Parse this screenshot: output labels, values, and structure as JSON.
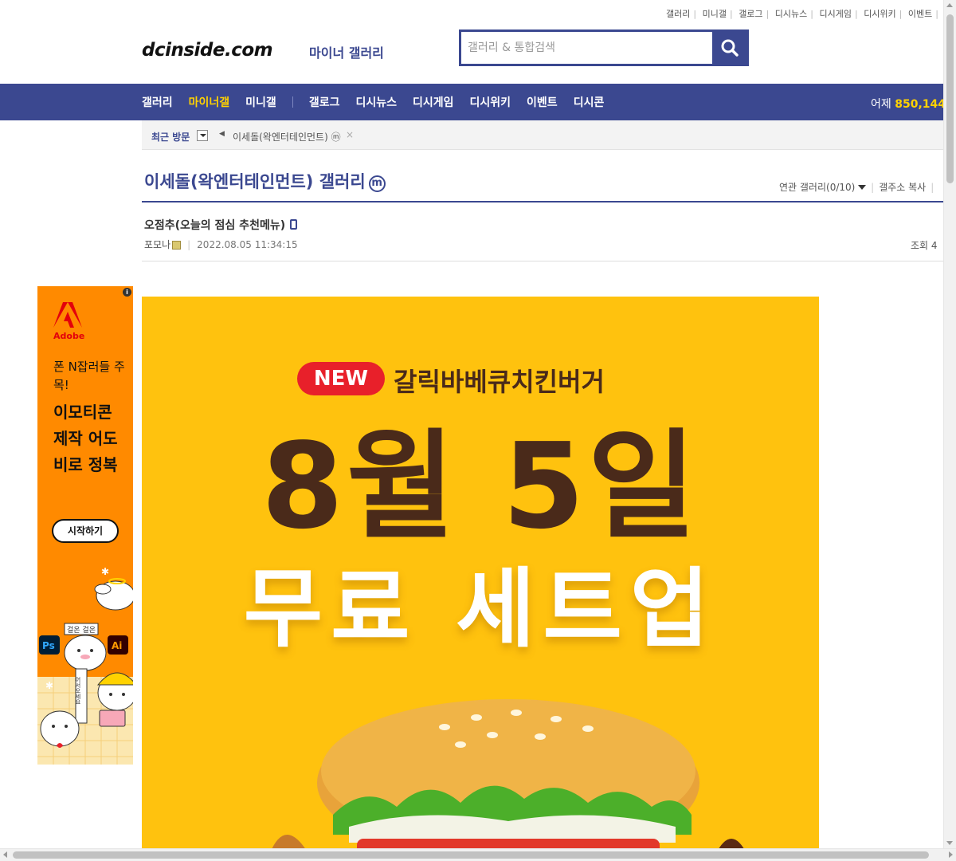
{
  "util_links": [
    "갤러리",
    "미니갤",
    "갤로그",
    "디시뉴스",
    "디시게임",
    "디시위키",
    "이벤트"
  ],
  "header": {
    "logo": "dcinside.com",
    "logo_sub": "마이너 갤러리",
    "search_placeholder": "갤러리 & 통합검색"
  },
  "nav": {
    "items": [
      "갤러리",
      "마이너갤",
      "미니갤",
      "갤로그",
      "디시뉴스",
      "디시게임",
      "디시위키",
      "이벤트",
      "디시콘"
    ],
    "active": "마이너갤",
    "visitors_label": "어제",
    "visitors_value": "850,144"
  },
  "recent": {
    "label": "최근 방문",
    "item": "이세돌(왁엔터테인먼트) ⓜ",
    "close": "×"
  },
  "gallery": {
    "title": "이세돌(왁엔터테인먼트) 갤러리",
    "badge": "m",
    "related": "연관 갤러리(0/10)",
    "copy_address": "갤주소 복사"
  },
  "post": {
    "title": "오점추(오늘의 점심 추천메뉴)",
    "author": "포모나",
    "date": "2022.08.05 11:34:15",
    "views_label": "조회 4"
  },
  "ad": {
    "info": "i",
    "brand": "Adobe",
    "line1": "폰 N잡러들 주목!",
    "line2": "이모티콘 제작 어도비로 정복",
    "cta": "시작하기",
    "art_tag": "걸온 걸온",
    "art_vertical": "어서오세요",
    "ps_label": "Ps",
    "ai_label": "Ai"
  },
  "main_image": {
    "badge": "NEW",
    "subtitle": "갈릭바베큐치킨버거",
    "headline": "8월 5일",
    "promo": "무료 세트업"
  },
  "colors": {
    "brand_blue": "#3b4890",
    "active_yellow": "#ffd200",
    "ad_orange": "#ff8a00",
    "poster_yellow": "#ffc20e",
    "poster_brown": "#4a2a1a"
  }
}
